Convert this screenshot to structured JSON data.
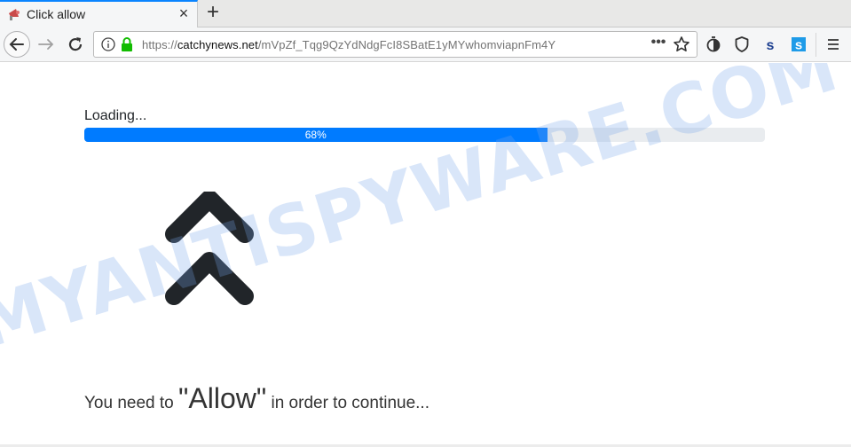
{
  "browser": {
    "tab": {
      "title": "Click allow",
      "close_label": "×"
    },
    "new_tab_label": "+",
    "url": {
      "scheme": "https://",
      "domain": "catchynews.net",
      "path": "/mVpZf_Tqg9QzYdNdgFcI8SBatE1yMYwhomviapnFm4Y"
    },
    "url_more_label": "•••",
    "toolbar_icons": [
      "tracking-icon",
      "shield-icon",
      "s-extension-icon",
      "s-square-extension-icon",
      "menu-icon"
    ],
    "colors": {
      "accent": "#0a84ff",
      "lock_green": "#12bc00"
    }
  },
  "page": {
    "loading_label": "Loading...",
    "progress": {
      "percent": 68,
      "label": "68%",
      "bar_color": "#007bff",
      "track_color": "#e9ecef"
    },
    "cta": {
      "prefix": "You need to",
      "emphasis": "\"Allow\"",
      "suffix": "in order to continue..."
    },
    "arrow_color": "#212529"
  },
  "watermark": {
    "text": "MYANTISPYWARE.COM"
  }
}
